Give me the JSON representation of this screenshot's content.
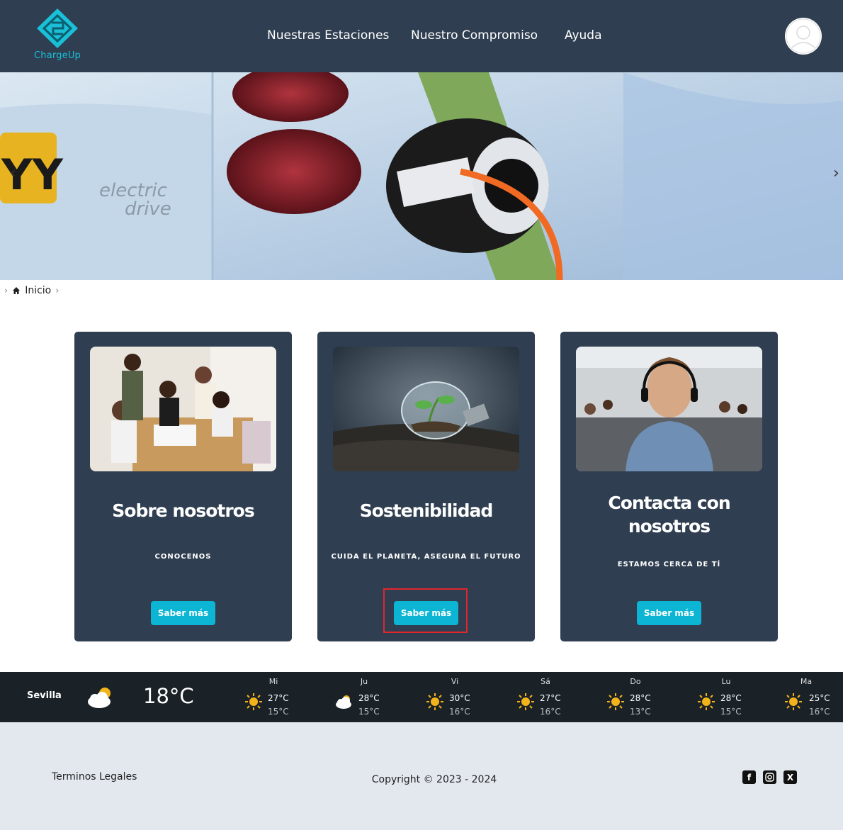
{
  "header": {
    "logo_text": "ChargeUp",
    "nav": [
      {
        "label": "Nuestras Estaciones"
      },
      {
        "label": "Nuestro Compromiso"
      },
      {
        "label": "Ayuda"
      }
    ]
  },
  "hero": {
    "badge_text": "electric drive",
    "plate_text": "YY"
  },
  "breadcrumb": {
    "home_label": "Inicio"
  },
  "cards": [
    {
      "title": "Sobre nosotros",
      "subtitle": "CONOCENOS",
      "button": "Saber más"
    },
    {
      "title": "Sostenibilidad",
      "subtitle": "CUIDA EL PLANETA, ASEGURA EL FUTURO",
      "button": "Saber más"
    },
    {
      "title": "Contacta con nosotros",
      "subtitle": "ESTAMOS CERCA DE TÍ",
      "button": "Saber más"
    }
  ],
  "weather": {
    "city": "Sevilla",
    "current_temp": "18°C",
    "current_icon": "partly-cloudy-icon",
    "days": [
      {
        "name": "Mi",
        "hi": "27°C",
        "lo": "15°C",
        "icon": "sun-icon"
      },
      {
        "name": "Ju",
        "hi": "28°C",
        "lo": "15°C",
        "icon": "cloud-icon"
      },
      {
        "name": "Vi",
        "hi": "30°C",
        "lo": "16°C",
        "icon": "sun-icon"
      },
      {
        "name": "Sá",
        "hi": "27°C",
        "lo": "16°C",
        "icon": "sun-icon"
      },
      {
        "name": "Do",
        "hi": "28°C",
        "lo": "13°C",
        "icon": "sun-icon"
      },
      {
        "name": "Lu",
        "hi": "28°C",
        "lo": "15°C",
        "icon": "sun-icon"
      },
      {
        "name": "Ma",
        "hi": "25°C",
        "lo": "16°C",
        "icon": "sun-icon"
      }
    ]
  },
  "footer": {
    "legal": "Terminos Legales",
    "copyright": "Copyright © 2023 - 2024",
    "social": [
      "facebook-icon",
      "instagram-icon",
      "x-icon"
    ]
  },
  "colors": {
    "header_bg": "#2f3e51",
    "accent": "#0bb5d3",
    "card_bg": "#2f3e51",
    "footer_bg": "#e3e8ef",
    "highlight": "#e0262d"
  }
}
